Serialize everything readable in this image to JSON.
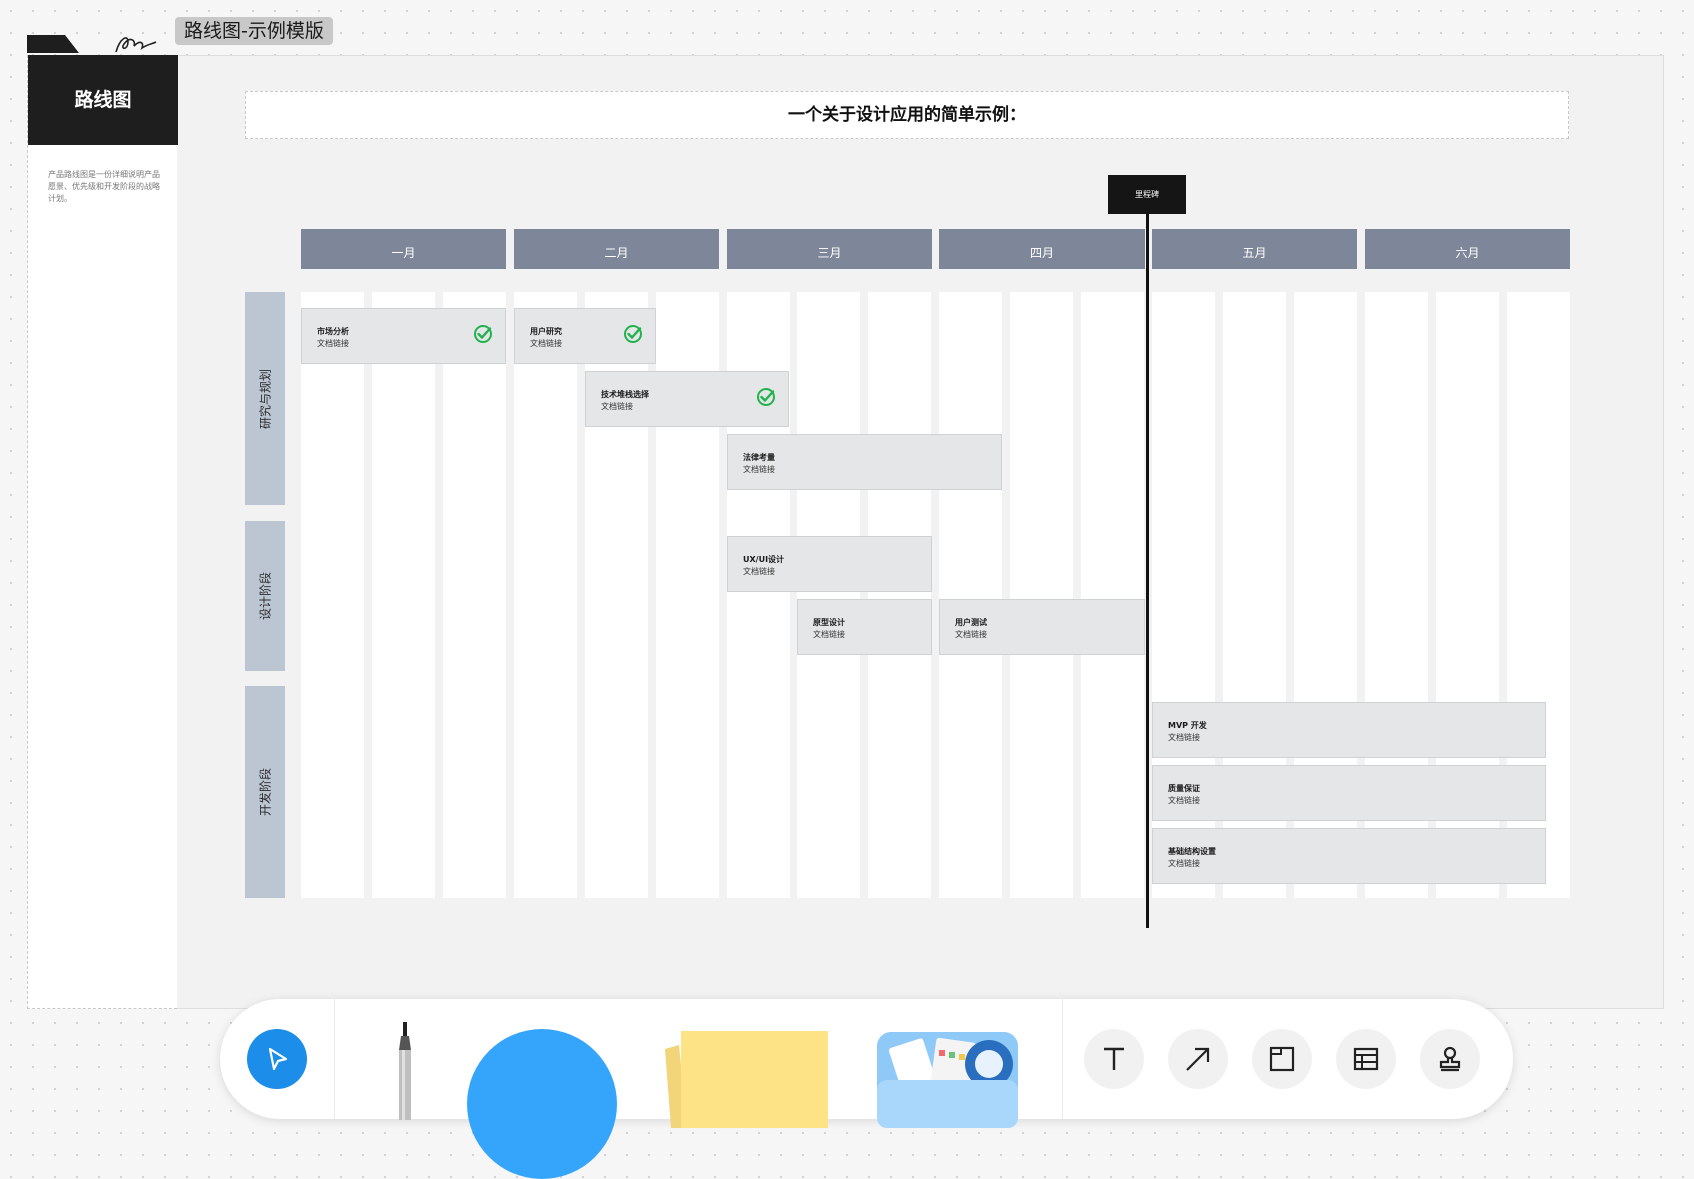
{
  "frame": {
    "tab_title": "路线图-示例模版"
  },
  "sidebar": {
    "heading": "路线图",
    "description": "产品路线图是一份详细说明产品愿景、优先级和开发阶段的战略计划。"
  },
  "roadmap": {
    "title": "一个关于设计应用的简单示例：",
    "milestone": "里程碑",
    "months": [
      "一月",
      "二月",
      "三月",
      "四月",
      "五月",
      "六月"
    ],
    "lanes": [
      "研究与规划",
      "设计阶段",
      "开发阶段"
    ],
    "tasks": [
      {
        "name": "市场分析",
        "link": "文档链接",
        "done": true
      },
      {
        "name": "用户研究",
        "link": "文档链接",
        "done": true
      },
      {
        "name": "技术堆栈选择",
        "link": "文档链接",
        "done": true
      },
      {
        "name": "法律考量",
        "link": "文档链接",
        "done": false
      },
      {
        "name": "UX/UI设计",
        "link": "文档链接",
        "done": false
      },
      {
        "name": "原型设计",
        "link": "文档链接",
        "done": false
      },
      {
        "name": "用户测试",
        "link": "文档链接",
        "done": false
      },
      {
        "name": "MVP 开发",
        "link": "文档链接",
        "done": false
      },
      {
        "name": "质量保证",
        "link": "文档链接",
        "done": false
      },
      {
        "name": "基础结构设置",
        "link": "文档链接",
        "done": false
      }
    ]
  },
  "toolbar": {
    "text_tool_glyph": "T",
    "tools": [
      "select-icon",
      "pen-icon",
      "shape-icon",
      "sticky-note-icon",
      "media-icon",
      "text-icon",
      "arrow-icon",
      "frame-icon",
      "table-icon",
      "stamp-icon"
    ]
  },
  "colors": {
    "month_header": "#7e8799",
    "lane": "#bcc6d3",
    "task": "#e4e6e7",
    "check": "#22b24c",
    "accent": "#1c8de8"
  }
}
